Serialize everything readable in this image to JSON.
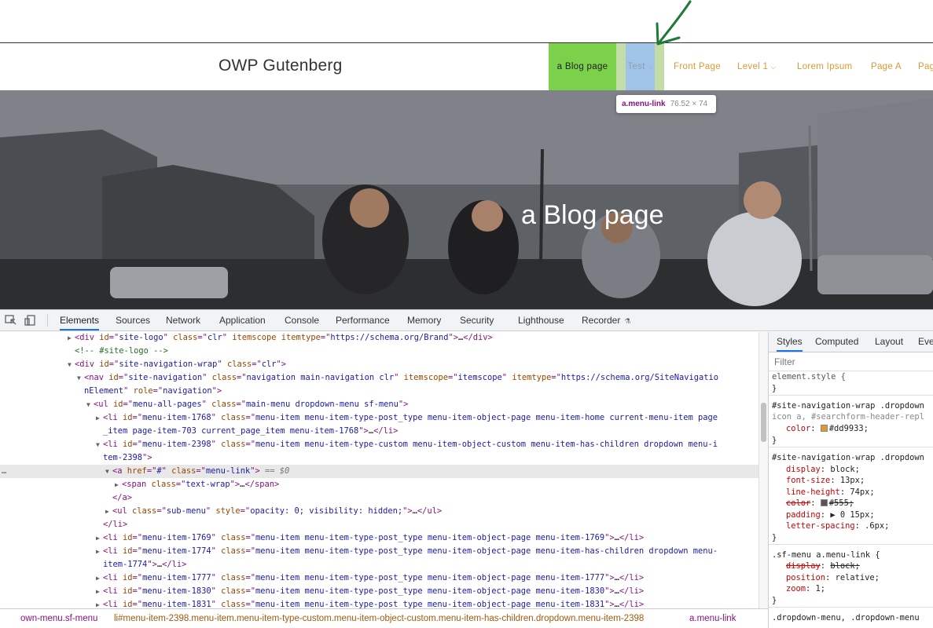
{
  "site": {
    "logo": "OWP Gutenberg",
    "nav": [
      {
        "label": "a Blog page"
      },
      {
        "label": "Test"
      },
      {
        "label": "Front Page"
      },
      {
        "label": "Level 1"
      },
      {
        "label": "Lorem Ipsum"
      },
      {
        "label": "Page A"
      },
      {
        "label": "Pag"
      }
    ],
    "tooltip": {
      "tag": "a.menu-link",
      "size": "76.52 × 74"
    },
    "hero_title": "a Blog page"
  },
  "devtools": {
    "tabs": [
      "Elements",
      "Sources",
      "Network",
      "Application",
      "Console",
      "Performance",
      "Memory",
      "Security",
      "Lighthouse",
      "Recorder"
    ],
    "active_tab": "Elements",
    "dom_lines": [
      [
        {
          "c": "tag",
          "t": "<div "
        },
        {
          "c": "an",
          "t": "id"
        },
        {
          "c": "tag",
          "t": "=\""
        },
        {
          "c": "av",
          "t": "site-logo"
        },
        {
          "c": "tag",
          "t": "\" "
        },
        {
          "c": "an",
          "t": "class"
        },
        {
          "c": "tag",
          "t": "=\""
        },
        {
          "c": "av",
          "t": "clr"
        },
        {
          "c": "tag",
          "t": "\" "
        },
        {
          "c": "an",
          "t": "itemscope itemtype"
        },
        {
          "c": "tag",
          "t": "=\""
        },
        {
          "c": "av",
          "t": "https://schema.org/Brand"
        },
        {
          "c": "tag",
          "t": "\">"
        },
        {
          "c": "",
          "t": "…"
        },
        {
          "c": "tag",
          "t": "</div>"
        }
      ],
      [
        {
          "c": "cm",
          "t": "<!-- #site-logo -->"
        }
      ],
      [
        {
          "c": "tag",
          "t": "<div "
        },
        {
          "c": "an",
          "t": "id"
        },
        {
          "c": "tag",
          "t": "=\""
        },
        {
          "c": "av",
          "t": "site-navigation-wrap"
        },
        {
          "c": "tag",
          "t": "\" "
        },
        {
          "c": "an",
          "t": "class"
        },
        {
          "c": "tag",
          "t": "=\""
        },
        {
          "c": "av",
          "t": "clr"
        },
        {
          "c": "tag",
          "t": "\">"
        }
      ],
      [
        {
          "c": "tag",
          "t": "<nav "
        },
        {
          "c": "an",
          "t": "id"
        },
        {
          "c": "tag",
          "t": "=\""
        },
        {
          "c": "av",
          "t": "site-navigation"
        },
        {
          "c": "tag",
          "t": "\" "
        },
        {
          "c": "an",
          "t": "class"
        },
        {
          "c": "tag",
          "t": "=\""
        },
        {
          "c": "av",
          "t": "navigation main-navigation clr"
        },
        {
          "c": "tag",
          "t": "\" "
        },
        {
          "c": "an",
          "t": "itemscope"
        },
        {
          "c": "tag",
          "t": "=\""
        },
        {
          "c": "av",
          "t": "itemscope"
        },
        {
          "c": "tag",
          "t": "\" "
        },
        {
          "c": "an",
          "t": "itemtype"
        },
        {
          "c": "tag",
          "t": "=\""
        },
        {
          "c": "av",
          "t": "https://schema.org/SiteNavigatio"
        }
      ],
      [
        {
          "c": "av",
          "t": "nElement"
        },
        {
          "c": "tag",
          "t": "\" "
        },
        {
          "c": "an",
          "t": "role"
        },
        {
          "c": "tag",
          "t": "=\""
        },
        {
          "c": "av",
          "t": "navigation"
        },
        {
          "c": "tag",
          "t": "\">"
        }
      ],
      [
        {
          "c": "tag",
          "t": "<ul "
        },
        {
          "c": "an",
          "t": "id"
        },
        {
          "c": "tag",
          "t": "=\""
        },
        {
          "c": "av",
          "t": "menu-all-pages"
        },
        {
          "c": "tag",
          "t": "\" "
        },
        {
          "c": "an",
          "t": "class"
        },
        {
          "c": "tag",
          "t": "=\""
        },
        {
          "c": "av",
          "t": "main-menu dropdown-menu sf-menu"
        },
        {
          "c": "tag",
          "t": "\">"
        }
      ],
      [
        {
          "c": "tag",
          "t": "<li "
        },
        {
          "c": "an",
          "t": "id"
        },
        {
          "c": "tag",
          "t": "=\""
        },
        {
          "c": "av",
          "t": "menu-item-1768"
        },
        {
          "c": "tag",
          "t": "\" "
        },
        {
          "c": "an",
          "t": "class"
        },
        {
          "c": "tag",
          "t": "=\""
        },
        {
          "c": "av",
          "t": "menu-item menu-item-type-post_type menu-item-object-page menu-item-home current-menu-item page"
        }
      ],
      [
        {
          "c": "av",
          "t": "_item page-item-703 current_page_item menu-item-1768"
        },
        {
          "c": "tag",
          "t": "\">"
        },
        {
          "c": "",
          "t": "…"
        },
        {
          "c": "tag",
          "t": "</li>"
        }
      ],
      [
        {
          "c": "tag",
          "t": "<li "
        },
        {
          "c": "an",
          "t": "id"
        },
        {
          "c": "tag",
          "t": "=\""
        },
        {
          "c": "av",
          "t": "menu-item-2398"
        },
        {
          "c": "tag",
          "t": "\" "
        },
        {
          "c": "an",
          "t": "class"
        },
        {
          "c": "tag",
          "t": "=\""
        },
        {
          "c": "av",
          "t": "menu-item menu-item-type-custom menu-item-object-custom menu-item-has-children dropdown menu-i"
        }
      ],
      [
        {
          "c": "av",
          "t": "tem-2398"
        },
        {
          "c": "tag",
          "t": "\">"
        }
      ],
      [
        {
          "c": "tag",
          "t": "<a "
        },
        {
          "c": "an",
          "t": "href"
        },
        {
          "c": "tag",
          "t": "=\""
        },
        {
          "c": "av",
          "t": "#"
        },
        {
          "c": "tag",
          "t": "\" "
        },
        {
          "c": "an",
          "t": "class"
        },
        {
          "c": "tag",
          "t": "=\""
        },
        {
          "c": "av",
          "t": "menu-link"
        },
        {
          "c": "tag",
          "t": "\">"
        },
        {
          "c": "eq",
          "t": " == $0"
        }
      ],
      [
        {
          "c": "tag",
          "t": "<span "
        },
        {
          "c": "an",
          "t": "class"
        },
        {
          "c": "tag",
          "t": "=\""
        },
        {
          "c": "av",
          "t": "text-wrap"
        },
        {
          "c": "tag",
          "t": "\">"
        },
        {
          "c": "",
          "t": "…"
        },
        {
          "c": "tag",
          "t": "</span>"
        }
      ],
      [
        {
          "c": "tag",
          "t": "</a>"
        }
      ],
      [
        {
          "c": "tag",
          "t": "<ul "
        },
        {
          "c": "an",
          "t": "class"
        },
        {
          "c": "tag",
          "t": "=\""
        },
        {
          "c": "av",
          "t": "sub-menu"
        },
        {
          "c": "tag",
          "t": "\" "
        },
        {
          "c": "an",
          "t": "style"
        },
        {
          "c": "tag",
          "t": "=\""
        },
        {
          "c": "av",
          "t": "opacity: 0; visibility: hidden;"
        },
        {
          "c": "tag",
          "t": "\">"
        },
        {
          "c": "",
          "t": "…"
        },
        {
          "c": "tag",
          "t": "</ul>"
        }
      ],
      [
        {
          "c": "tag",
          "t": "</li>"
        }
      ],
      [
        {
          "c": "tag",
          "t": "<li "
        },
        {
          "c": "an",
          "t": "id"
        },
        {
          "c": "tag",
          "t": "=\""
        },
        {
          "c": "av",
          "t": "menu-item-1769"
        },
        {
          "c": "tag",
          "t": "\" "
        },
        {
          "c": "an",
          "t": "class"
        },
        {
          "c": "tag",
          "t": "=\""
        },
        {
          "c": "av",
          "t": "menu-item menu-item-type-post_type menu-item-object-page menu-item-1769"
        },
        {
          "c": "tag",
          "t": "\">"
        },
        {
          "c": "",
          "t": "…"
        },
        {
          "c": "tag",
          "t": "</li>"
        }
      ],
      [
        {
          "c": "tag",
          "t": "<li "
        },
        {
          "c": "an",
          "t": "id"
        },
        {
          "c": "tag",
          "t": "=\""
        },
        {
          "c": "av",
          "t": "menu-item-1774"
        },
        {
          "c": "tag",
          "t": "\" "
        },
        {
          "c": "an",
          "t": "class"
        },
        {
          "c": "tag",
          "t": "=\""
        },
        {
          "c": "av",
          "t": "menu-item menu-item-type-post_type menu-item-object-page menu-item-has-children dropdown menu-"
        }
      ],
      [
        {
          "c": "av",
          "t": "item-1774"
        },
        {
          "c": "tag",
          "t": "\">"
        },
        {
          "c": "",
          "t": "…"
        },
        {
          "c": "tag",
          "t": "</li>"
        }
      ],
      [
        {
          "c": "tag",
          "t": "<li "
        },
        {
          "c": "an",
          "t": "id"
        },
        {
          "c": "tag",
          "t": "=\""
        },
        {
          "c": "av",
          "t": "menu-item-1777"
        },
        {
          "c": "tag",
          "t": "\" "
        },
        {
          "c": "an",
          "t": "class"
        },
        {
          "c": "tag",
          "t": "=\""
        },
        {
          "c": "av",
          "t": "menu-item menu-item-type-post_type menu-item-object-page menu-item-1777"
        },
        {
          "c": "tag",
          "t": "\">"
        },
        {
          "c": "",
          "t": "…"
        },
        {
          "c": "tag",
          "t": "</li>"
        }
      ],
      [
        {
          "c": "tag",
          "t": "<li "
        },
        {
          "c": "an",
          "t": "id"
        },
        {
          "c": "tag",
          "t": "=\""
        },
        {
          "c": "av",
          "t": "menu-item-1830"
        },
        {
          "c": "tag",
          "t": "\" "
        },
        {
          "c": "an",
          "t": "class"
        },
        {
          "c": "tag",
          "t": "=\""
        },
        {
          "c": "av",
          "t": "menu-item menu-item-type-post_type menu-item-object-page menu-item-1830"
        },
        {
          "c": "tag",
          "t": "\">"
        },
        {
          "c": "",
          "t": "…"
        },
        {
          "c": "tag",
          "t": "</li>"
        }
      ],
      [
        {
          "c": "tag",
          "t": "<li "
        },
        {
          "c": "an",
          "t": "id"
        },
        {
          "c": "tag",
          "t": "=\""
        },
        {
          "c": "av",
          "t": "menu-item-1831"
        },
        {
          "c": "tag",
          "t": "\" "
        },
        {
          "c": "an",
          "t": "class"
        },
        {
          "c": "tag",
          "t": "=\""
        },
        {
          "c": "av",
          "t": "menu-item menu-item-type-post_type menu-item-object-page menu-item-1831"
        },
        {
          "c": "tag",
          "t": "\">"
        },
        {
          "c": "",
          "t": "…"
        },
        {
          "c": "tag",
          "t": "</li>"
        }
      ]
    ],
    "breadcrumb": [
      "own-menu.sf-menu",
      "li#menu-item-2398.menu-item.menu-item-type-custom.menu-item-object-custom.menu-item-has-children.dropdown.menu-item-2398",
      "a.menu-link"
    ],
    "styles_tabs": [
      "Styles",
      "Computed",
      "Layout",
      "Eve"
    ],
    "filter_placeholder": "Filter",
    "styles_lines": [
      {
        "kind": "sel",
        "text": "element.style {"
      },
      {
        "kind": "close",
        "text": "}"
      },
      {
        "kind": "sel",
        "text": "#site-navigation-wrap .dropdown"
      },
      {
        "kind": "sel2",
        "text": "icon a, #searchform-header-repl"
      },
      {
        "kind": "decl",
        "prop": "color",
        "val": "#dd9933;",
        "swatch": "#dd9933"
      },
      {
        "kind": "close",
        "text": "}"
      },
      {
        "kind": "sel",
        "text": "#site-navigation-wrap .dropdown"
      },
      {
        "kind": "decl",
        "prop": "display",
        "val": "block;"
      },
      {
        "kind": "decl",
        "prop": "font-size",
        "val": "13px;"
      },
      {
        "kind": "decl",
        "prop": "line-height",
        "val": "74px;"
      },
      {
        "kind": "decl",
        "prop": "color",
        "val": "#555;",
        "swatch": "#555555",
        "strike": true
      },
      {
        "kind": "decl",
        "prop": "padding",
        "val": "▶ 0 15px;"
      },
      {
        "kind": "decl",
        "prop": "letter-spacing",
        "val": ".6px;"
      },
      {
        "kind": "close",
        "text": "}"
      },
      {
        "kind": "sel",
        "text": ".sf-menu a.menu-link {"
      },
      {
        "kind": "decl",
        "prop": "display",
        "val": "block;",
        "strike": true
      },
      {
        "kind": "decl",
        "prop": "position",
        "val": "relative;"
      },
      {
        "kind": "decl",
        "prop": "zoom",
        "val": "1;"
      },
      {
        "kind": "close",
        "text": "}"
      },
      {
        "kind": "sel",
        "text": ".dropdown-menu, .dropdown-menu"
      }
    ]
  }
}
